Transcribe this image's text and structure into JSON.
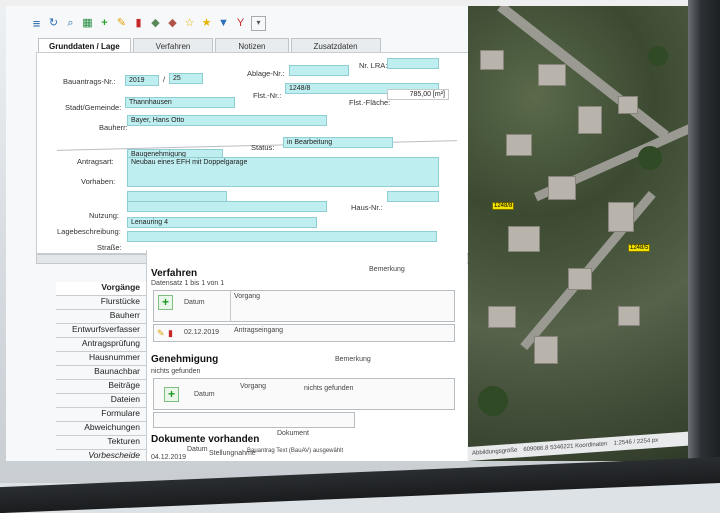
{
  "toolbar": {
    "icons": [
      "menu-icon",
      "refresh-icon",
      "search-icon",
      "export-icon",
      "add-icon",
      "edit-icon",
      "delete-icon",
      "layer-add-icon",
      "layer-remove-icon",
      "star-icon",
      "star-folder-icon",
      "filter-icon",
      "filter-clear-icon",
      "dropdown-icon"
    ]
  },
  "tabs": [
    "Grunddaten / Lage",
    "Verfahren",
    "Notizen",
    "Zusatzdaten"
  ],
  "form": {
    "bauantrags_label": "Bauantrags-Nr.:",
    "bauantrags_year": "2019",
    "slash": "/",
    "bauantrags_no": "25",
    "ablage_label": "Ablage-Nr.:",
    "ablage_value": "",
    "lra_label": "Nr. LRA:",
    "lra_value": "",
    "stadt_label": "Stadt/Gemeinde:",
    "stadt_value": "Thannhausen",
    "flst_label": "Flst.-Nr.:",
    "flst_value": "1248/8",
    "flaeche_label": "Flst.-Fläche:",
    "flaeche_value": "785,00 [m²]",
    "bauherr_label": "Bauherr:",
    "bauherr_value": "Bayer, Hans Otto",
    "antragsart_label": "Antragsart:",
    "antragsart_value": "Baugenehmigung",
    "status_label": "Status:",
    "status_value": "in Bearbeitung",
    "vorhaben_label": "Vorhaben:",
    "vorhaben_value": "Neubau eines EFH mit Doppelgarage",
    "nutzung_label": "Nutzung:",
    "nutzung_value": "",
    "hausnr_label": "Haus-Nr.:",
    "hausnr_value": "",
    "lage_label": "Lagebeschreibung:",
    "lage_value": "Lenauring 4",
    "strasse_label": "Straße:",
    "strasse_value": ""
  },
  "sidebar": {
    "items": [
      "Vorgänge",
      "Flurstücke",
      "Bauherr",
      "Entwurfsverfasser",
      "Antragsprüfung",
      "Hausnummer",
      "Baunachbar",
      "Beiträge",
      "Dateien",
      "Formulare",
      "Abweichungen",
      "Tekturen",
      "Vorbescheide"
    ],
    "active": "Vorgänge"
  },
  "verfahren": {
    "title": "Verfahren",
    "count": "Datensatz 1 bis 1 von 1",
    "col_bemerkung": "Bemerkung",
    "col_datum": "Datum",
    "col_vorgang": "Vorgang",
    "row_datum": "02.12.2019",
    "row_vorgang": "Antragseingang"
  },
  "genehmigung": {
    "title": "Genehmigung",
    "count": "nichts gefunden",
    "col_bemerkung": "Bemerkung",
    "col_datum": "Datum",
    "col_vorgang": "Vorgang",
    "empty": "nichts gefunden"
  },
  "dokumente": {
    "title": "Dokumente vorhanden",
    "col_datum": "Datum",
    "col_dokument": "Dokument",
    "row_datum": "04.12.2019",
    "row_dokument": "Stellungnahme",
    "footer": "Bauantrag Text (BauAV) ausgewählt"
  },
  "map": {
    "markers": [
      "1248/8",
      "1248/5"
    ],
    "status_a": "Abbildungsgröße",
    "status_b": "609086.8 5346221 Koordinaten",
    "status_c": "1:2546 / 2254 px"
  }
}
